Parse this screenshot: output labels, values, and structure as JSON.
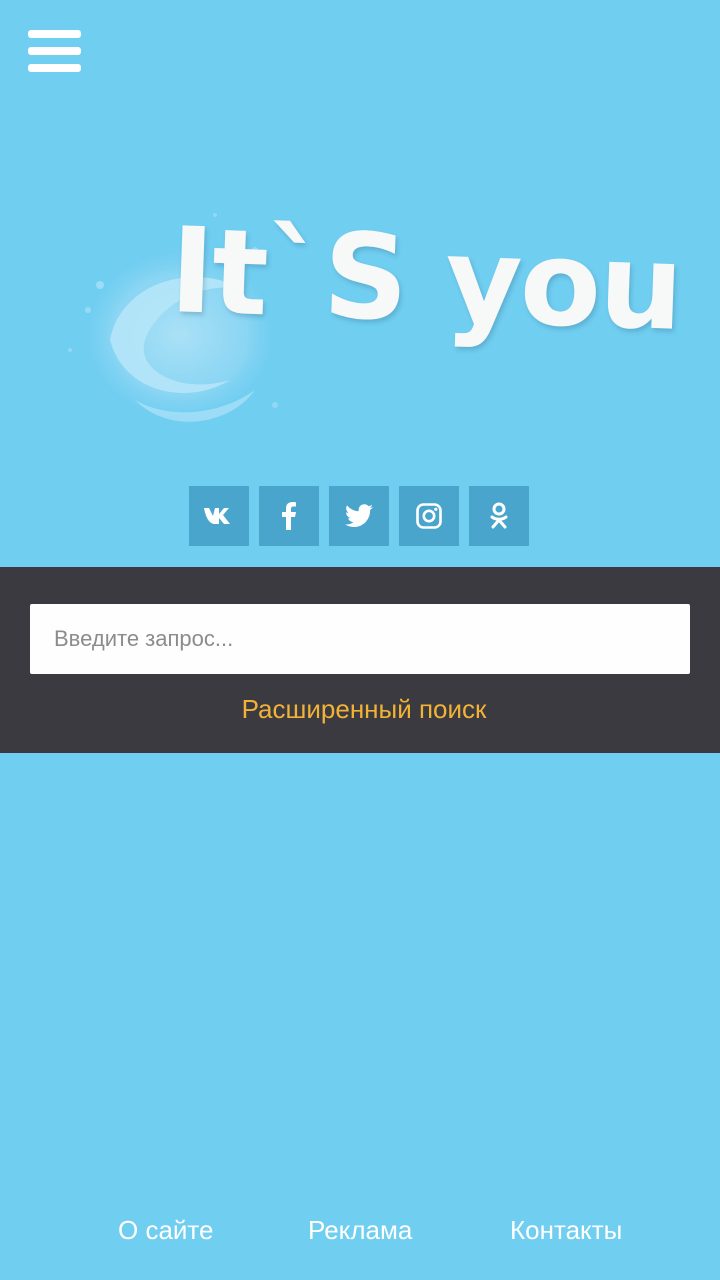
{
  "header": {
    "menu_icon": "hamburger-menu-icon"
  },
  "logo": {
    "text": "It`S you"
  },
  "social": [
    {
      "name": "vk",
      "icon": "vk-icon"
    },
    {
      "name": "facebook",
      "icon": "facebook-icon"
    },
    {
      "name": "twitter",
      "icon": "twitter-icon"
    },
    {
      "name": "instagram",
      "icon": "instagram-icon"
    },
    {
      "name": "odnoklassniki",
      "icon": "odnoklassniki-icon"
    }
  ],
  "search": {
    "placeholder": "Введите запрос...",
    "value": "",
    "advanced_label": "Расширенный поиск"
  },
  "footer": {
    "links": [
      {
        "label": "О сайте"
      },
      {
        "label": "Реклама"
      },
      {
        "label": "Контакты"
      }
    ]
  },
  "colors": {
    "background": "#70cef1",
    "search_panel": "#3a3a40",
    "social_button": "#4aa5cd",
    "accent": "#f2b236",
    "white": "#ffffff"
  }
}
